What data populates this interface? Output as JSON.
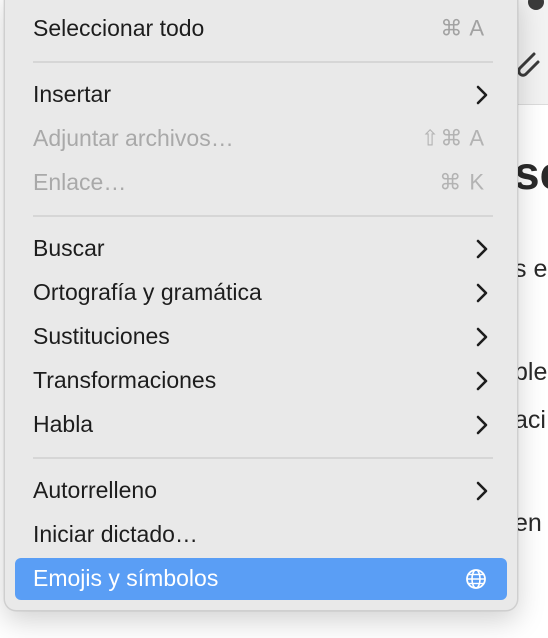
{
  "background": {
    "heading_fragment": "sc",
    "lines": [
      "s e",
      "ble",
      "aci",
      "en"
    ]
  },
  "menu": {
    "items": [
      {
        "label": "Seleccionar todo",
        "shortcut": "⌘ A"
      },
      {
        "label": "Insertar",
        "submenu": true
      },
      {
        "label": "Adjuntar archivos…",
        "shortcut": "⇧⌘ A",
        "disabled": true
      },
      {
        "label": "Enlace…",
        "shortcut": "⌘ K",
        "disabled": true
      },
      {
        "label": "Buscar",
        "submenu": true
      },
      {
        "label": "Ortografía y gramática",
        "submenu": true
      },
      {
        "label": "Sustituciones",
        "submenu": true
      },
      {
        "label": "Transformaciones",
        "submenu": true
      },
      {
        "label": "Habla",
        "submenu": true
      },
      {
        "label": "Autorrelleno",
        "submenu": true
      },
      {
        "label": "Iniciar dictado…"
      },
      {
        "label": "Emojis y símbolos",
        "icon": "globe-icon",
        "selected": true
      }
    ],
    "accent_color": "#5a9ef5"
  }
}
